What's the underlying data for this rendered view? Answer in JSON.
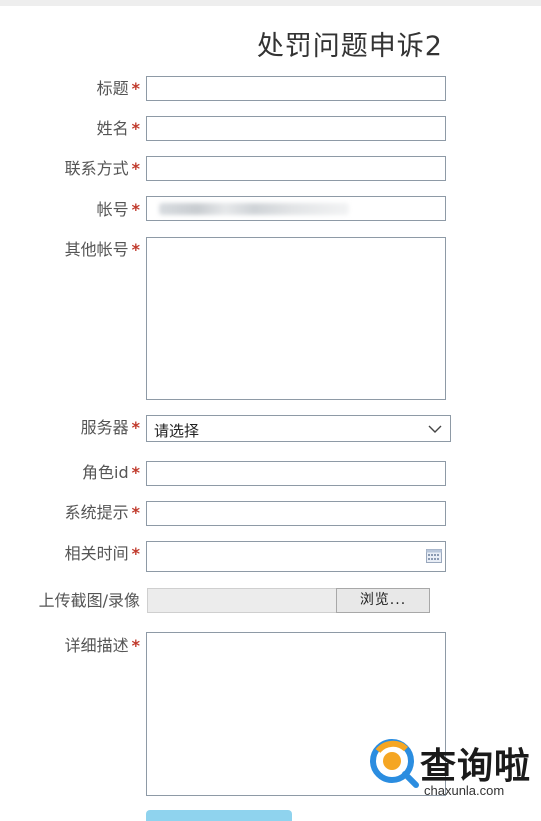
{
  "form": {
    "title": "处罚问题申诉2",
    "required_mark": "*",
    "fields": {
      "title": {
        "label": "标题"
      },
      "name": {
        "label": "姓名"
      },
      "contact": {
        "label": "联系方式"
      },
      "account": {
        "label": "帐号"
      },
      "other_accounts": {
        "label": "其他帐号"
      },
      "server": {
        "label": "服务器",
        "selected": "请选择"
      },
      "role_id": {
        "label": "角色id"
      },
      "system_hint": {
        "label": "系统提示"
      },
      "related_time": {
        "label": "相关时间"
      },
      "upload": {
        "label": "上传截图/录像",
        "browse_label": "浏览..."
      },
      "details": {
        "label": "详细描述"
      }
    }
  },
  "watermark": {
    "cn": "查询啦",
    "en": "chaxunla.com"
  },
  "colors": {
    "required": "#c0392b",
    "input_border": "#8e9aa6",
    "submit_button": "#8fd3ee",
    "watermark_orange": "#f5a623",
    "watermark_blue": "#2b8de0"
  },
  "icons": {
    "select": "chevron-down-icon",
    "date": "calendar-icon",
    "watermark": "search-logo-icon"
  }
}
